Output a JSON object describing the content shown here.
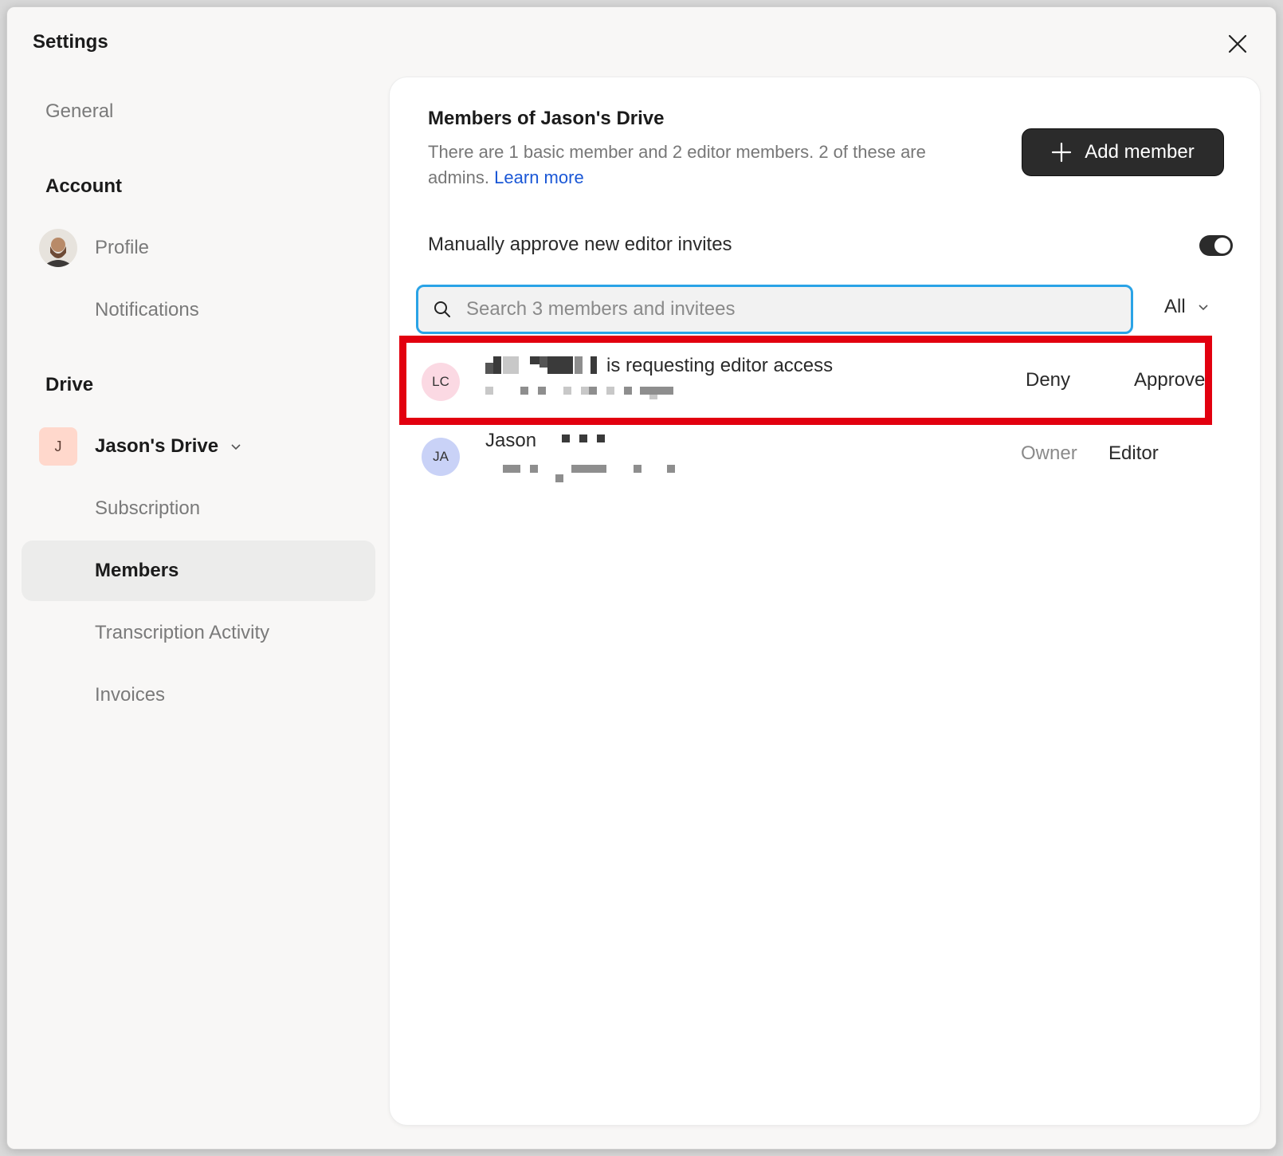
{
  "window": {
    "title": "Settings"
  },
  "sidebar": {
    "general": "General",
    "account_heading": "Account",
    "profile": "Profile",
    "notifications": "Notifications",
    "drive_heading": "Drive",
    "drive_badge": "J",
    "drive_name": "Jason's Drive",
    "subscription": "Subscription",
    "members": "Members",
    "transcription": "Transcription Activity",
    "invoices": "Invoices"
  },
  "panel": {
    "title": "Members of Jason's Drive",
    "description": "There are 1 basic member and 2 editor members. 2 of these are admins.",
    "learn_more": "Learn more",
    "add_member": "Add member",
    "manual_approve_label": "Manually approve new editor invites",
    "manual_approve_on": true,
    "search_placeholder": "Search 3 members and invitees",
    "filter_value": "All"
  },
  "members": [
    {
      "initials": "LC",
      "avatar_color": "#fbd9e3",
      "request_text": "is requesting editor access",
      "deny": "Deny",
      "approve": "Approve"
    },
    {
      "initials": "JA",
      "avatar_color": "#c9d2f7",
      "name": "Jason",
      "status": "Owner",
      "role": "Editor"
    }
  ],
  "colors": {
    "accent_blue": "#2aa3e6",
    "highlight_red": "#e2000f",
    "link": "#1a57d6"
  }
}
